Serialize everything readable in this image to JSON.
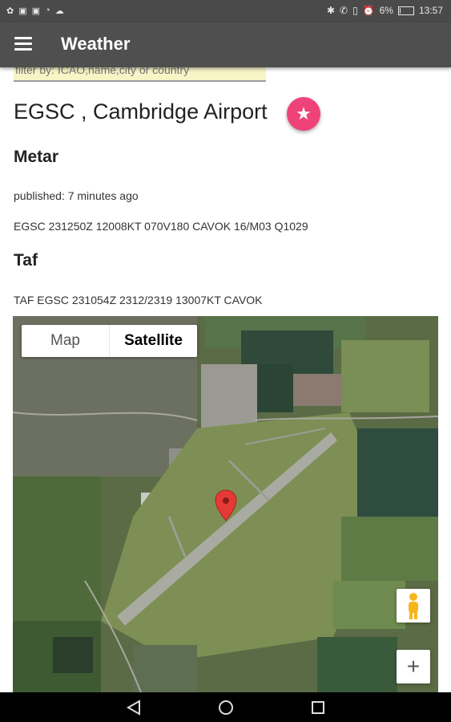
{
  "status_bar": {
    "battery": "6%",
    "battery_level": 0.06,
    "time": "13:57"
  },
  "app_bar": {
    "title": "Weather",
    "menu_icon": "hamburger-menu-icon"
  },
  "filter": {
    "placeholder": "filter by: ICAO,name,city or country"
  },
  "airport": {
    "title": "EGSC , Cambridge Airport",
    "favorite_icon": "star-icon",
    "favorite_color": "#f0427a"
  },
  "metar": {
    "heading": "Metar",
    "published": "published: 7 minutes ago",
    "report": "EGSC 231250Z 12008KT 070V180 CAVOK 16/M03 Q1029"
  },
  "taf": {
    "heading": "Taf",
    "report": "TAF EGSC 231054Z 2312/2319 13007KT CAVOK"
  },
  "map": {
    "tabs": [
      {
        "label": "Map",
        "selected": false
      },
      {
        "label": "Satellite",
        "selected": true
      }
    ],
    "zoom_in_label": "+",
    "pegman_icon": "pegman-icon",
    "marker_icon": "map-pin-icon",
    "marker_color": "#e53935"
  },
  "nav_bar": {
    "icons": [
      "back-icon",
      "home-icon",
      "recents-icon"
    ]
  }
}
